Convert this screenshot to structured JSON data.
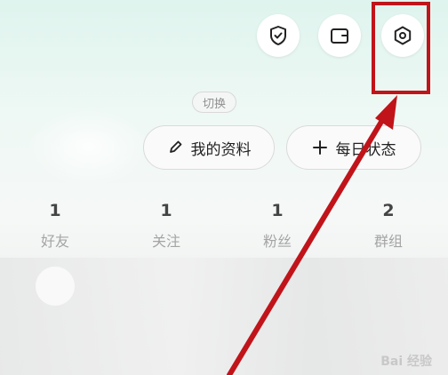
{
  "header": {
    "icons": [
      {
        "name": "shield-check-icon"
      },
      {
        "name": "wallet-icon"
      },
      {
        "name": "settings-hexagon-icon"
      }
    ]
  },
  "profile": {
    "switch_label": "切换",
    "edit_profile_label": "我的资料",
    "daily_status_label": "每日状态"
  },
  "stats": [
    {
      "count": "1",
      "label": "好友"
    },
    {
      "count": "1",
      "label": "关注"
    },
    {
      "count": "1",
      "label": "粉丝"
    },
    {
      "count": "2",
      "label": "群组"
    }
  ],
  "annotation": {
    "color": "#c0141a"
  },
  "watermark": {
    "text": "Bai 经验"
  }
}
